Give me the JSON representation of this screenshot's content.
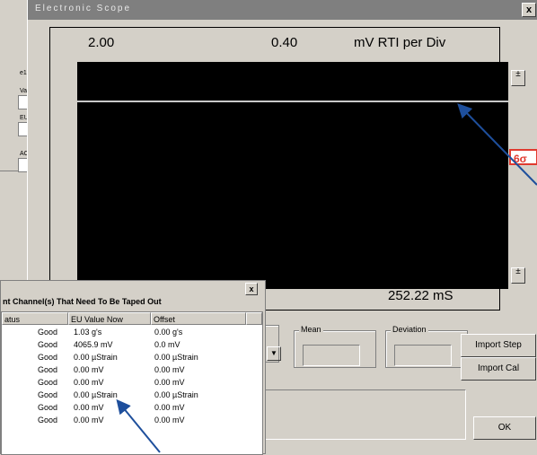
{
  "background_window": {
    "labels": [
      "e1",
      "Val",
      "EU",
      "AC"
    ]
  },
  "main_window": {
    "title": "Electronic Scope",
    "close_glyph": "x",
    "scope": {
      "left_value": "2.00",
      "mid_value": "0.40",
      "units": "mV RTI per Div",
      "time_label": "252.22 mS"
    },
    "side_buttons": [
      "±",
      "±"
    ],
    "flag_badge": "6σ",
    "groups": {
      "mean_label": "Mean",
      "deviation_label": "Deviation"
    },
    "buttons": {
      "import_step": "Import Step",
      "import_cal": "Import Cal",
      "ok": "OK"
    }
  },
  "dialog": {
    "close_glyph": "x",
    "header": "nt Channel(s) That Need To Be Taped Out",
    "columns": [
      "atus",
      "EU Value Now",
      "Offset"
    ],
    "rows": [
      {
        "status": "Good",
        "value": "1.03 g's",
        "offset": "0.00 g's"
      },
      {
        "status": "Good",
        "value": "4065.9 mV",
        "offset": "0.0 mV"
      },
      {
        "status": "Good",
        "value": "0.00 µStrain",
        "offset": "0.00 µStrain"
      },
      {
        "status": "Good",
        "value": "0.00 mV",
        "offset": "0.00 mV"
      },
      {
        "status": "Good",
        "value": "0.00 mV",
        "offset": "0.00 mV"
      },
      {
        "status": "Good",
        "value": "0.00 µStrain",
        "offset": "0.00 µStrain"
      },
      {
        "status": "Good",
        "value": "0.00 mV",
        "offset": "0.00 mV"
      },
      {
        "status": "Good",
        "value": "0.00 mV",
        "offset": "0.00 mV"
      }
    ]
  },
  "colors": {
    "annotation_arrow": "#1e4f9c",
    "scope_background": "#000000",
    "trace": "#c8c8c8",
    "flag": "#e03a2f"
  }
}
